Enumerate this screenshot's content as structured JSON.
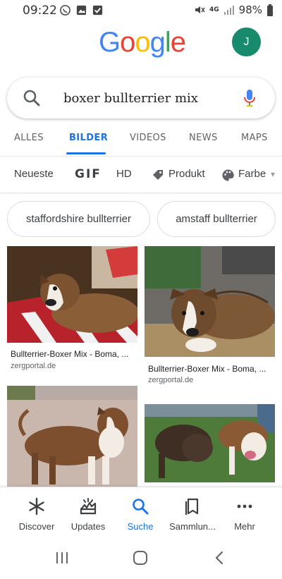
{
  "status_bar": {
    "time": "09:22",
    "network": "4G",
    "battery": "98%"
  },
  "header": {
    "logo": [
      "G",
      "o",
      "o",
      "g",
      "l",
      "e"
    ],
    "avatar_letter": "J"
  },
  "search": {
    "query": "boxer bullterrier mix"
  },
  "tabs": [
    {
      "label": "ALLES"
    },
    {
      "label": "BILDER",
      "active": true
    },
    {
      "label": "VIDEOS"
    },
    {
      "label": "NEWS"
    },
    {
      "label": "MAPS"
    }
  ],
  "filters": {
    "neueste": "Neueste",
    "gif": "GIF",
    "hd": "HD",
    "produkt": "Produkt",
    "farbe": "Farbe"
  },
  "chips": [
    "staffordshire bullterrier",
    "amstaff bullterrier"
  ],
  "results": [
    {
      "caption": "Bullterrier-Boxer Mix - Boma, ...",
      "source": "zergportal.de"
    },
    {
      "caption": "Bullterrier-Boxer Mix - Boma, ...",
      "source": "zergportal.de"
    }
  ],
  "bottom_nav": [
    {
      "label": "Discover",
      "icon": "asterisk-icon"
    },
    {
      "label": "Updates",
      "icon": "updates-icon"
    },
    {
      "label": "Suche",
      "icon": "search-icon",
      "active": true
    },
    {
      "label": "Sammlun...",
      "icon": "collections-icon"
    },
    {
      "label": "Mehr",
      "icon": "more-icon"
    }
  ],
  "colors": {
    "accent": "#1a73e8",
    "avatar": "#178b6b",
    "google_blue": "#4285f4",
    "google_red": "#ea4335",
    "google_yellow": "#fbbc05",
    "google_green": "#34a853"
  }
}
